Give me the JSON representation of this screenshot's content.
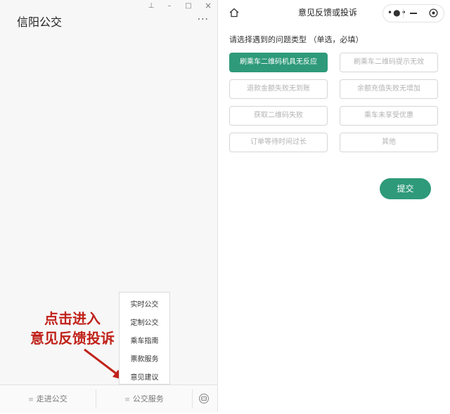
{
  "left": {
    "title": "信阳公交",
    "window_controls": {
      "pin": "⊥",
      "minimize": "–",
      "maximize": "□",
      "close": "×"
    },
    "more": "···",
    "popup_menu": [
      "实时公交",
      "定制公交",
      "乘车指南",
      "票款服务",
      "意见建议"
    ],
    "annotation": {
      "line1": "点击进入",
      "line2": "意见反馈投诉",
      "color": "#c0221a"
    },
    "footer_tabs": [
      {
        "label": "走进公交",
        "icon": "menu-icon"
      },
      {
        "label": "公交服务",
        "icon": "menu-icon"
      }
    ],
    "footer_right_icon": "robot-icon"
  },
  "right": {
    "title": "意见反馈或投诉",
    "home_icon": "home-icon",
    "capsule": {
      "more": "•●•",
      "minimize": "minimize-icon",
      "close": "close-circle-icon"
    },
    "question": "请选择遇到的问题类型 （单选，必填）",
    "options": [
      {
        "label": "刷乘车二维码机具无反应",
        "selected": true
      },
      {
        "label": "刷乘车二维码提示无效",
        "selected": false
      },
      {
        "label": "退款金额失败无到账",
        "selected": false
      },
      {
        "label": "余额充值失败无增加",
        "selected": false
      },
      {
        "label": "获取二维码失败",
        "selected": false
      },
      {
        "label": "乘车未享受优惠",
        "selected": false
      },
      {
        "label": "订单等待时间过长",
        "selected": false
      },
      {
        "label": "其他",
        "selected": false
      }
    ],
    "submit": "提交",
    "accent_color": "#2e9a7a"
  }
}
